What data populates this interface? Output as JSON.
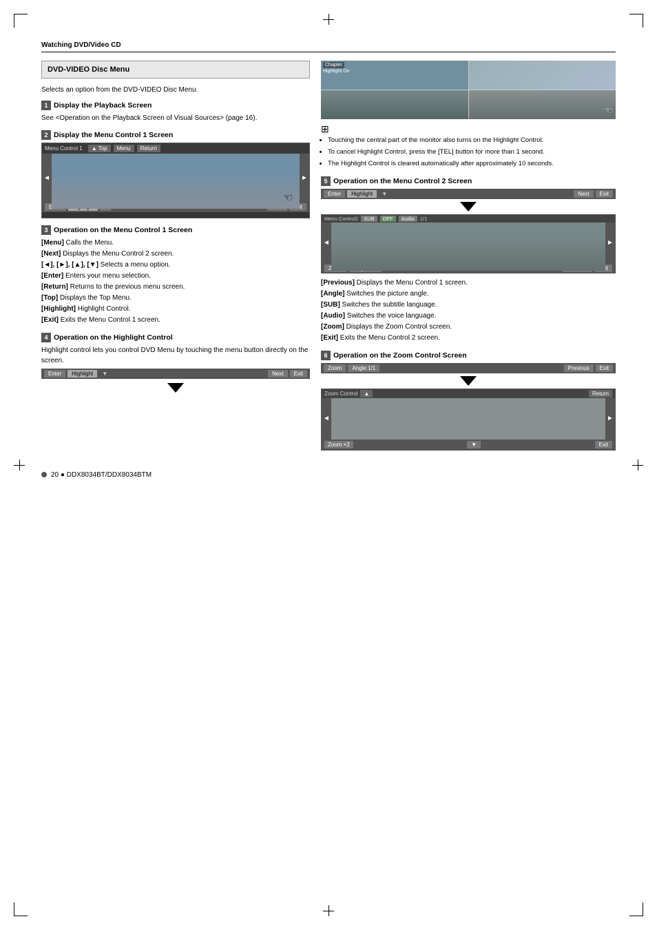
{
  "page": {
    "header": "Watching DVD/Video CD",
    "footer": "20 ● DDX8034BT/DDX8034BTM"
  },
  "section": {
    "title": "DVD-VIDEO Disc Menu",
    "intro": "Selects an option from the DVD-VIDEO Disc Menu."
  },
  "steps": [
    {
      "num": "1",
      "title": "Display the Playback Screen",
      "text": "See <Operation on the Playback Screen of Visual Sources> (page 16)."
    },
    {
      "num": "2",
      "title": "Display the Menu Control 1 Screen",
      "has_screen": true
    },
    {
      "num": "3",
      "title": "Operation on the Menu Control 1 Screen",
      "desc": [
        {
          "key": "[Menu]",
          "text": "  Calls the Menu."
        },
        {
          "key": "[Next]",
          "text": "  Displays the Menu Control 2 screen."
        },
        {
          "key": "[◄], [►], [▲], [▼]",
          "text": "  Selects a menu option."
        },
        {
          "key": "[Enter]",
          "text": "  Enters your menu selection."
        },
        {
          "key": "[Return]",
          "text": "  Returns to the previous menu screen."
        },
        {
          "key": "[Top]",
          "text": "  Displays the Top Menu."
        },
        {
          "key": "[Highlight]",
          "text": "  Highlight Control."
        },
        {
          "key": "[Exit]",
          "text": "  Exits the Menu Control 1 screen."
        }
      ]
    },
    {
      "num": "4",
      "title": "Operation on the Highlight Control",
      "text": "Highlight control lets you control DVD Menu by touching the menu button directly on the screen."
    },
    {
      "num": "5",
      "title": "Operation on the Menu Control 2 Screen",
      "desc": [
        {
          "key": "[Previous]",
          "text": "  Displays the Menu Control 1 screen."
        },
        {
          "key": "[Angle]",
          "text": "  Switches the picture angle."
        },
        {
          "key": "[SUB]",
          "text": "  Switches the subtitle language."
        },
        {
          "key": "[Audio]",
          "text": "  Switches the voice language."
        },
        {
          "key": "[Zoom]",
          "text": "  Displays the Zoom Control screen."
        },
        {
          "key": "[Exit]",
          "text": "  Exits the Menu Control 2 screen."
        }
      ]
    },
    {
      "num": "6",
      "title": "Operation on the Zoom Control Screen"
    }
  ],
  "notes": [
    "Touching the central part of the monitor also turns on the Highlight Control.",
    "To cancel Highlight Control, press the [TEL] button for more than 1 second.",
    "The Highlight Control is cleared automatically after approximately 10 seconds."
  ],
  "menu_bar": {
    "title": "Menu Control 1",
    "top_btn": "▲  Top",
    "menu_btn": "Menu",
    "return_btn": "Return"
  },
  "bottom_bar": {
    "enter_btn": "Enter",
    "highlight_btn": "Highlight",
    "v_btn": "▼",
    "next_btn": "Next",
    "exit_btn": "Exit"
  },
  "mc2_bar": {
    "title": "Menu Control2",
    "sub_btn": "SUB",
    "off_btn": "OFF",
    "audio_btn": "Audio",
    "ratio_btn": "1/1"
  },
  "mc2_bottom": {
    "zoom_btn": "Zoom",
    "angle_btn": "Angle 1/1",
    "previous_btn": "Previous",
    "exit_btn": "Exit"
  },
  "zoom_bar": {
    "zoom_btn": "Zoom",
    "angle_btn": "Angle 1/1",
    "previous_btn": "Previous",
    "exit_btn": "Exit"
  },
  "zoom_control": {
    "title": "Zoom Control",
    "return_btn": "Return",
    "zoom_label": "Zoom ×2",
    "exit_btn": "Exit",
    "up_btn": "▲",
    "down_btn": "▼"
  },
  "chapter_label": "Chapter",
  "highlight_on_label": "Highlight On"
}
